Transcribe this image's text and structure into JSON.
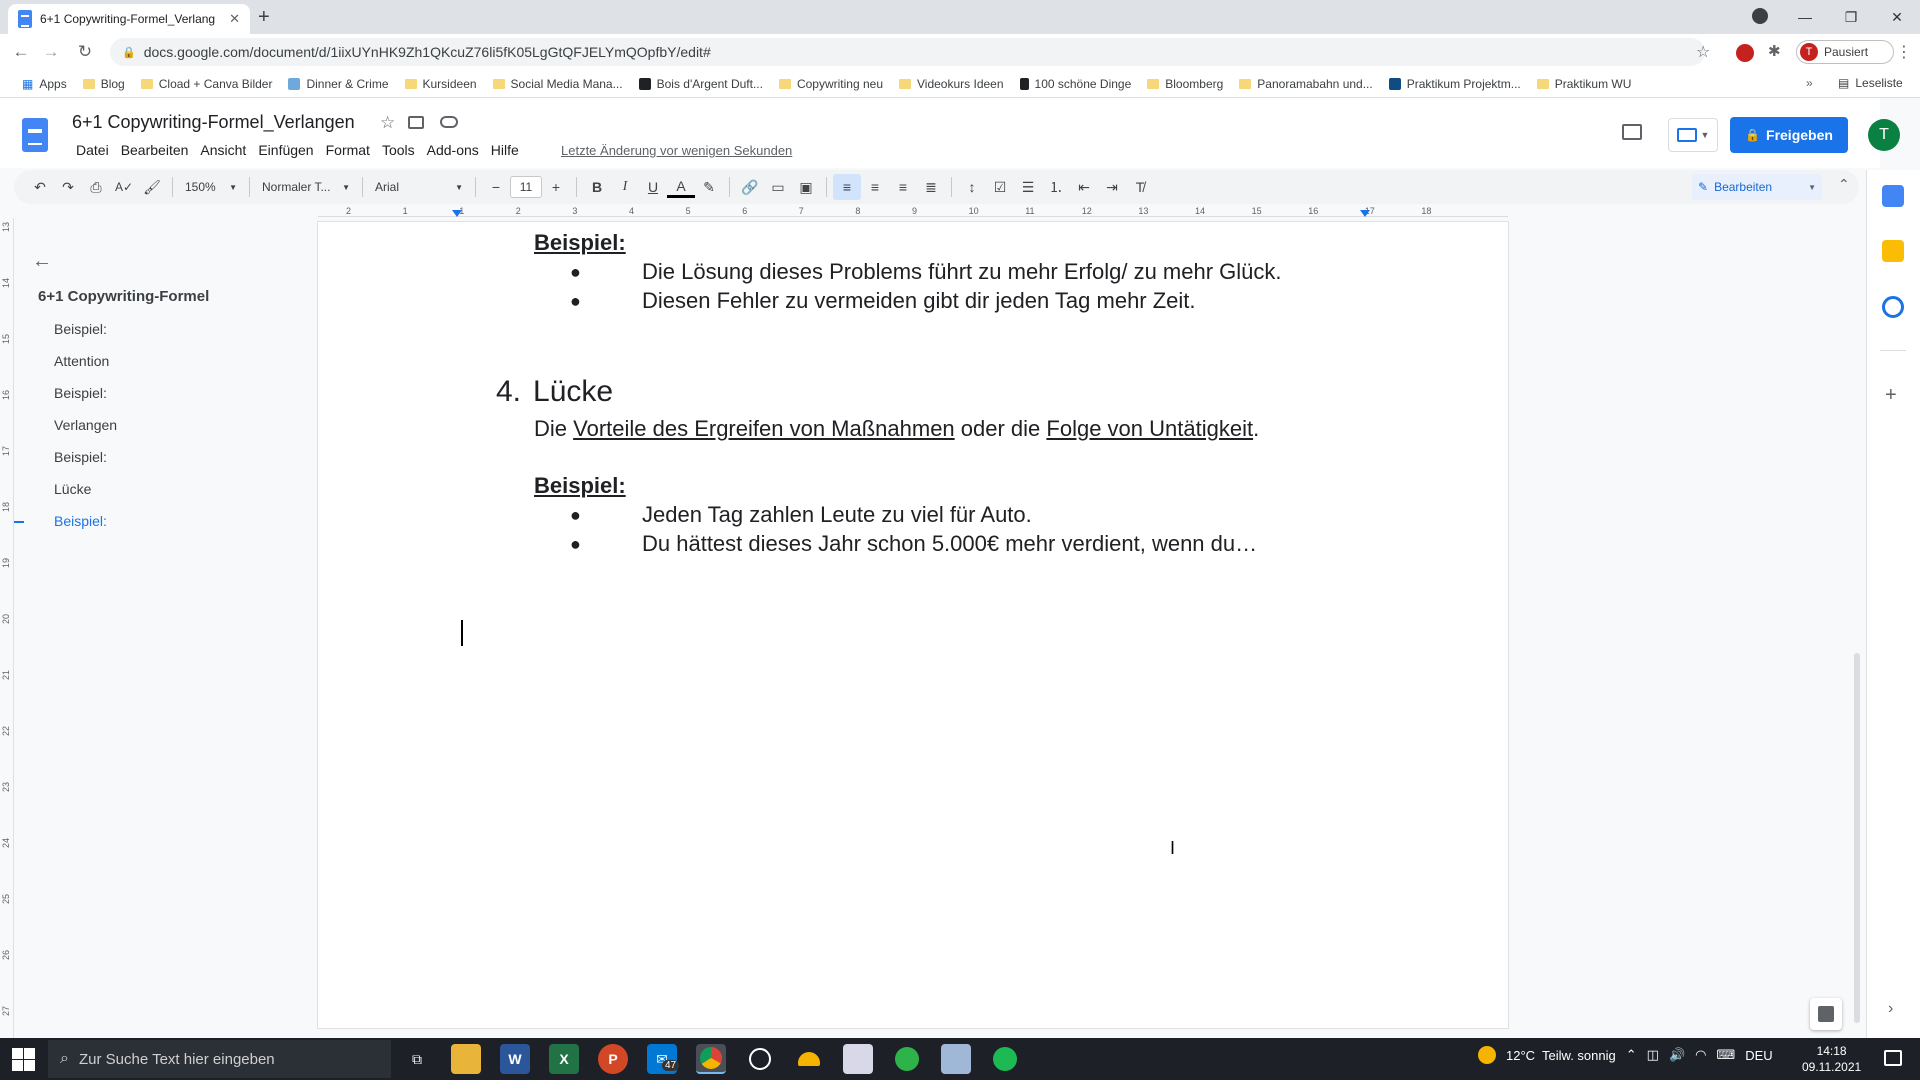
{
  "browser": {
    "tab_title": "6+1 Copywriting-Formel_Verlang",
    "url": "docs.google.com/document/d/1iixUYnHK9Zh1QKcuZ76li5fK05LgGtQFJELYmQOpfbY/edit#",
    "profile_label": "Pausiert",
    "profile_initial": "T",
    "bookmarks": [
      "Apps",
      "Blog",
      "Cload + Canva Bilder",
      "Dinner & Crime",
      "Kursideen",
      "Social Media Mana...",
      "Bois d'Argent Duft...",
      "Copywriting neu",
      "Videokurs Ideen",
      "100 schöne Dinge",
      "Bloomberg",
      "Panoramabahn und...",
      "Praktikum Projektm...",
      "Praktikum WU"
    ],
    "reading_list": "Leseliste"
  },
  "docs": {
    "title": "6+1 Copywriting-Formel_Verlangen",
    "menu": [
      "Datei",
      "Bearbeiten",
      "Ansicht",
      "Einfügen",
      "Format",
      "Tools",
      "Add-ons",
      "Hilfe"
    ],
    "last_edit": "Letzte Änderung vor wenigen Sekunden",
    "share_label": "Freigeben",
    "user_initial": "T",
    "toolbar": {
      "zoom": "150%",
      "style": "Normaler T...",
      "font": "Arial",
      "font_size": "11",
      "mode": "Bearbeiten"
    },
    "ruler_ticks": [
      "2",
      "1",
      "1",
      "2",
      "3",
      "4",
      "5",
      "6",
      "7",
      "8",
      "9",
      "10",
      "11",
      "12",
      "13",
      "14",
      "15",
      "16",
      "17",
      "18"
    ],
    "vruler_ticks": [
      "13",
      "14",
      "15",
      "16",
      "17",
      "18",
      "19",
      "20",
      "21",
      "22",
      "23",
      "24",
      "25",
      "26",
      "27"
    ]
  },
  "outline": {
    "title": "6+1 Copywriting-Formel",
    "items": [
      "Beispiel:",
      "Attention",
      "Beispiel:",
      "Verlangen",
      "Beispiel:",
      "Lücke",
      "Beispiel:"
    ],
    "active_index": 6
  },
  "document": {
    "section3_heading": "Beispiel:",
    "section3_bullets": [
      "Die Lösung dieses Problems führt zu mehr Erfolg/ zu mehr Glück.",
      "Diesen Fehler zu vermeiden gibt dir jeden Tag mehr Zeit."
    ],
    "section4_number": "4.",
    "section4_title": "Lücke",
    "section4_intro_1": "Die ",
    "section4_link_1": "Vorteile des Ergreifen von Maßnahmen",
    "section4_intro_2": " oder die ",
    "section4_link_2": "Folge von Untätigkeit",
    "section4_intro_3": ".",
    "section4_heading": "Beispiel:",
    "section4_bullets": [
      "Jeden Tag zahlen Leute zu viel für Auto.",
      "Du hättest dieses Jahr schon 5.000€ mehr verdient, wenn du…"
    ]
  },
  "taskbar": {
    "search_placeholder": "Zur Suche Text hier eingeben",
    "mail_badge": "47",
    "weather": "12°C  Teilw. sonnig",
    "language": "DEU",
    "time": "14:18",
    "date": "09.11.2021"
  },
  "colors": {
    "accent": "#1a73e8",
    "docs_blue": "#4285f4",
    "avatar_green": "#0b8043"
  }
}
